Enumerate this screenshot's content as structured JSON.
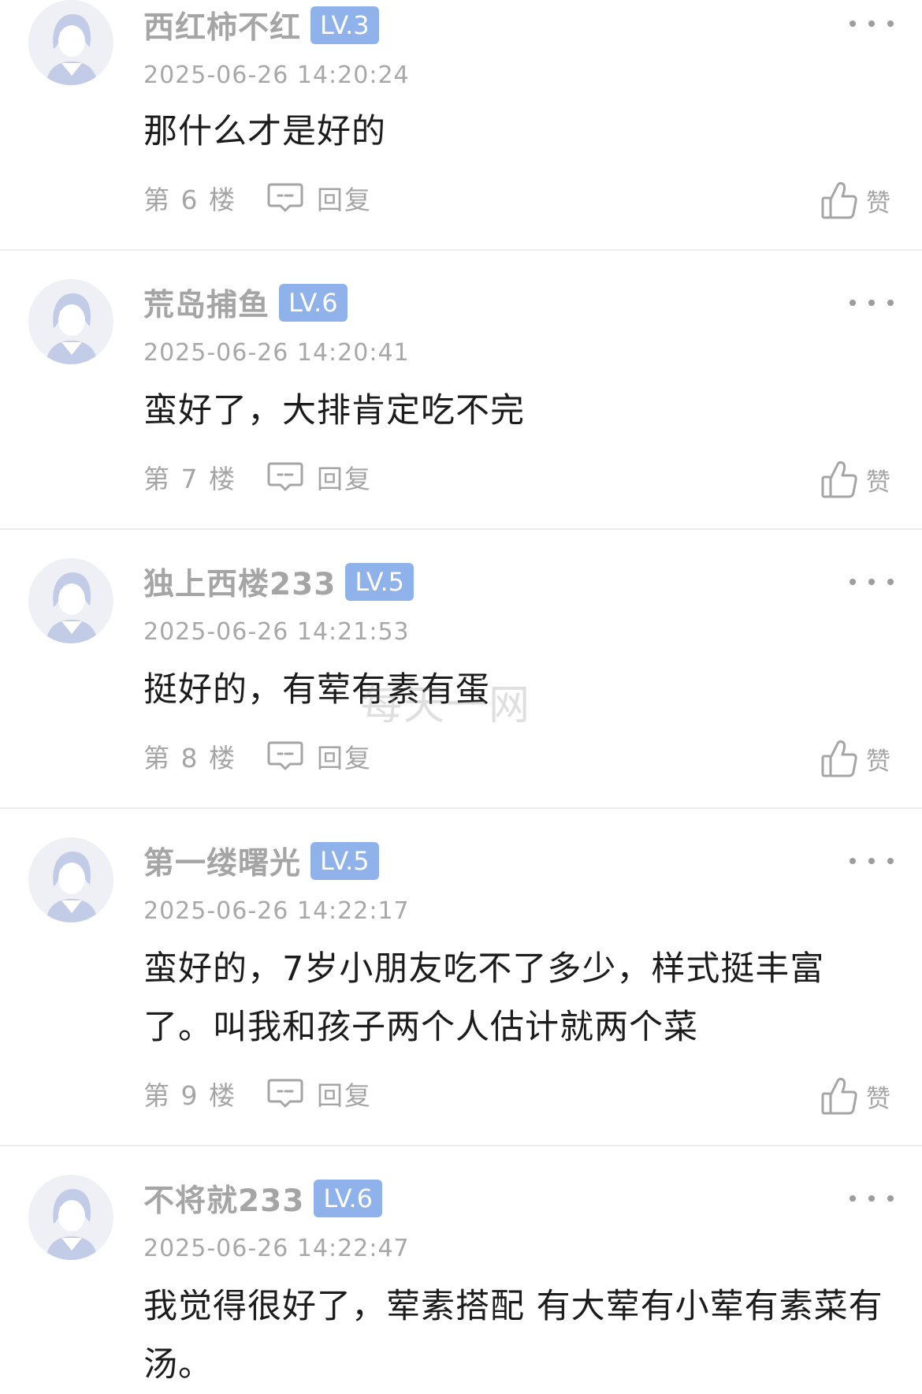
{
  "comments": [
    {
      "username": "西红柿不红",
      "level": "LV.3",
      "timestamp": "2025-06-26 14:20:24",
      "content": "那什么才是好的",
      "floor": "第 6 楼",
      "reply_label": "回复",
      "like_label": "赞"
    },
    {
      "username": "荒岛捕鱼",
      "level": "LV.6",
      "timestamp": "2025-06-26 14:20:41",
      "content": "蛮好了，大排肯定吃不完",
      "floor": "第 7 楼",
      "reply_label": "回复",
      "like_label": "赞"
    },
    {
      "username": "独上西楼233",
      "level": "LV.5",
      "timestamp": "2025-06-26 14:21:53",
      "content": "挺好的，有荤有素有蛋",
      "floor": "第 8 楼",
      "reply_label": "回复",
      "like_label": "赞"
    },
    {
      "username": "第一缕曙光",
      "level": "LV.5",
      "timestamp": "2025-06-26 14:22:17",
      "content": "蛮好的，7岁小朋友吃不了多少，样式挺丰富了。叫我和孩子两个人估计就两个菜",
      "floor": "第 9 楼",
      "reply_label": "回复",
      "like_label": "赞"
    },
    {
      "username": "不将就233",
      "level": "LV.6",
      "timestamp": "2025-06-26 14:22:47",
      "content": "我觉得很好了，荤素搭配 有大荤有小荤有素菜有汤。"
    }
  ],
  "watermark": "每天一网"
}
